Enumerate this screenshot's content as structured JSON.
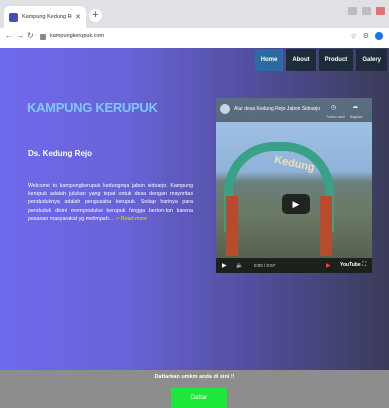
{
  "browser": {
    "tab_title": "Kampung Kedung Rejo",
    "url": "kampungkerupuk.com"
  },
  "nav": {
    "items": [
      {
        "label": "Home",
        "active": true
      },
      {
        "label": "About",
        "active": false
      },
      {
        "label": "Product",
        "active": false
      },
      {
        "label": "Galery",
        "active": false
      }
    ]
  },
  "hero": {
    "title": "KAMPUNG KERUPUK",
    "subtitle": "Ds. Kedung Rejo",
    "description": "Welcome to kampungkerupuk kedungreja jabon sidoarjo. Kampung kerupuk adalah julukan yang tepat untuk desa dengan mayoritas penduduknya adalah pengusaha kerupuk. Setiap harinya para penduduk disini memproduksi kerupuk hingga berton-ton karena pesanan masyarakat yg melimpah...",
    "read_more": "-> Read more"
  },
  "video": {
    "title": "Alur desa Kedung Rejo Jabon Sidoarjo",
    "watch_later": "Tonton nanti",
    "share": "Bagikan",
    "time": "0:00 / 0:57",
    "platform": "YouTube",
    "sign_text": "Kedung"
  },
  "footer": {
    "text": "Daftarkan umkm anda di sini !!",
    "button": "Daftar"
  },
  "colors": {
    "title": "#7ec8ff",
    "read_more": "#ffd600",
    "nav_active": "#2c6aa5",
    "nav_bg": "#1f2a3a",
    "button": "#1ee83a",
    "footer": "#8d8d8d"
  }
}
